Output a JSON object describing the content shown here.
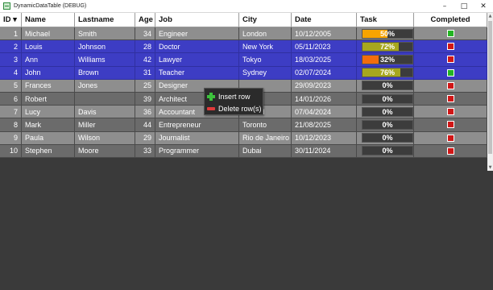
{
  "window": {
    "title": "DynamicDataTable (DEBUG)",
    "minimize": "–",
    "maximize": "□",
    "close": "✕"
  },
  "columns": [
    {
      "label": "ID ▾",
      "key": "id"
    },
    {
      "label": "Name",
      "key": "name"
    },
    {
      "label": "Lastname",
      "key": "lastname"
    },
    {
      "label": "Age",
      "key": "age"
    },
    {
      "label": "Job",
      "key": "job"
    },
    {
      "label": "City",
      "key": "city"
    },
    {
      "label": "Date",
      "key": "date"
    },
    {
      "label": "Task",
      "key": "task"
    },
    {
      "label": "Completed",
      "key": "completed"
    }
  ],
  "rows": [
    {
      "id": "1",
      "name": "Michael",
      "lastname": "Smith",
      "age": "34",
      "job": "Engineer",
      "city": "London",
      "date": "10/12/2005",
      "task": 50,
      "task_label": "50%",
      "task_color": "#f7a400",
      "completed": true,
      "shade": "light"
    },
    {
      "id": "2",
      "name": "Louis",
      "lastname": "Johnson",
      "age": "28",
      "job": "Doctor",
      "city": "New York",
      "date": "05/11/2023",
      "task": 72,
      "task_label": "72%",
      "task_color": "#a7a71e",
      "completed": false,
      "shade": "selected"
    },
    {
      "id": "3",
      "name": "Ann",
      "lastname": "Williams",
      "age": "42",
      "job": "Lawyer",
      "city": "Tokyo",
      "date": "18/03/2025",
      "task": 32,
      "task_label": "32%",
      "task_color": "#f26d0d",
      "completed": false,
      "shade": "selected"
    },
    {
      "id": "4",
      "name": "John",
      "lastname": "Brown",
      "age": "31",
      "job": "Teacher",
      "city": "Sydney",
      "date": "02/07/2024",
      "task": 76,
      "task_label": "76%",
      "task_color": "#a7a71e",
      "completed": true,
      "shade": "selected"
    },
    {
      "id": "5",
      "name": "Frances",
      "lastname": "Jones",
      "age": "25",
      "job": "Designer",
      "city": "",
      "date": "29/09/2023",
      "task": 0,
      "task_label": "0%",
      "task_color": "#3c3c3c",
      "completed": false,
      "shade": "light"
    },
    {
      "id": "6",
      "name": "Robert",
      "lastname": "",
      "age": "39",
      "job": "Architect",
      "city": "",
      "date": "14/01/2026",
      "task": 0,
      "task_label": "0%",
      "task_color": "#3c3c3c",
      "completed": false,
      "shade": "dark"
    },
    {
      "id": "7",
      "name": "Lucy",
      "lastname": "Davis",
      "age": "36",
      "job": "Accountant",
      "city": "Madrid",
      "date": "07/04/2024",
      "task": 0,
      "task_label": "0%",
      "task_color": "#3c3c3c",
      "completed": false,
      "shade": "light"
    },
    {
      "id": "8",
      "name": "Mark",
      "lastname": "Miller",
      "age": "44",
      "job": "Entrepreneur",
      "city": "Toronto",
      "date": "21/08/2025",
      "task": 0,
      "task_label": "0%",
      "task_color": "#3c3c3c",
      "completed": false,
      "shade": "dark"
    },
    {
      "id": "9",
      "name": "Paula",
      "lastname": "Wilson",
      "age": "29",
      "job": "Journalist",
      "city": "Rio de Janeiro",
      "date": "10/12/2023",
      "task": 0,
      "task_label": "0%",
      "task_color": "#3c3c3c",
      "completed": false,
      "shade": "light"
    },
    {
      "id": "10",
      "name": "Stephen",
      "lastname": "Moore",
      "age": "33",
      "job": "Programmer",
      "city": "Dubai",
      "date": "30/11/2024",
      "task": 0,
      "task_label": "0%",
      "task_color": "#3c3c3c",
      "completed": false,
      "shade": "dark"
    }
  ],
  "completed_colors": {
    "true": "#22b422",
    "false": "#d01616"
  },
  "context_menu": {
    "items": [
      {
        "label": "Insert row",
        "icon": "plus-icon"
      },
      {
        "label": "Delete row(s)",
        "icon": "minus-icon"
      }
    ]
  }
}
